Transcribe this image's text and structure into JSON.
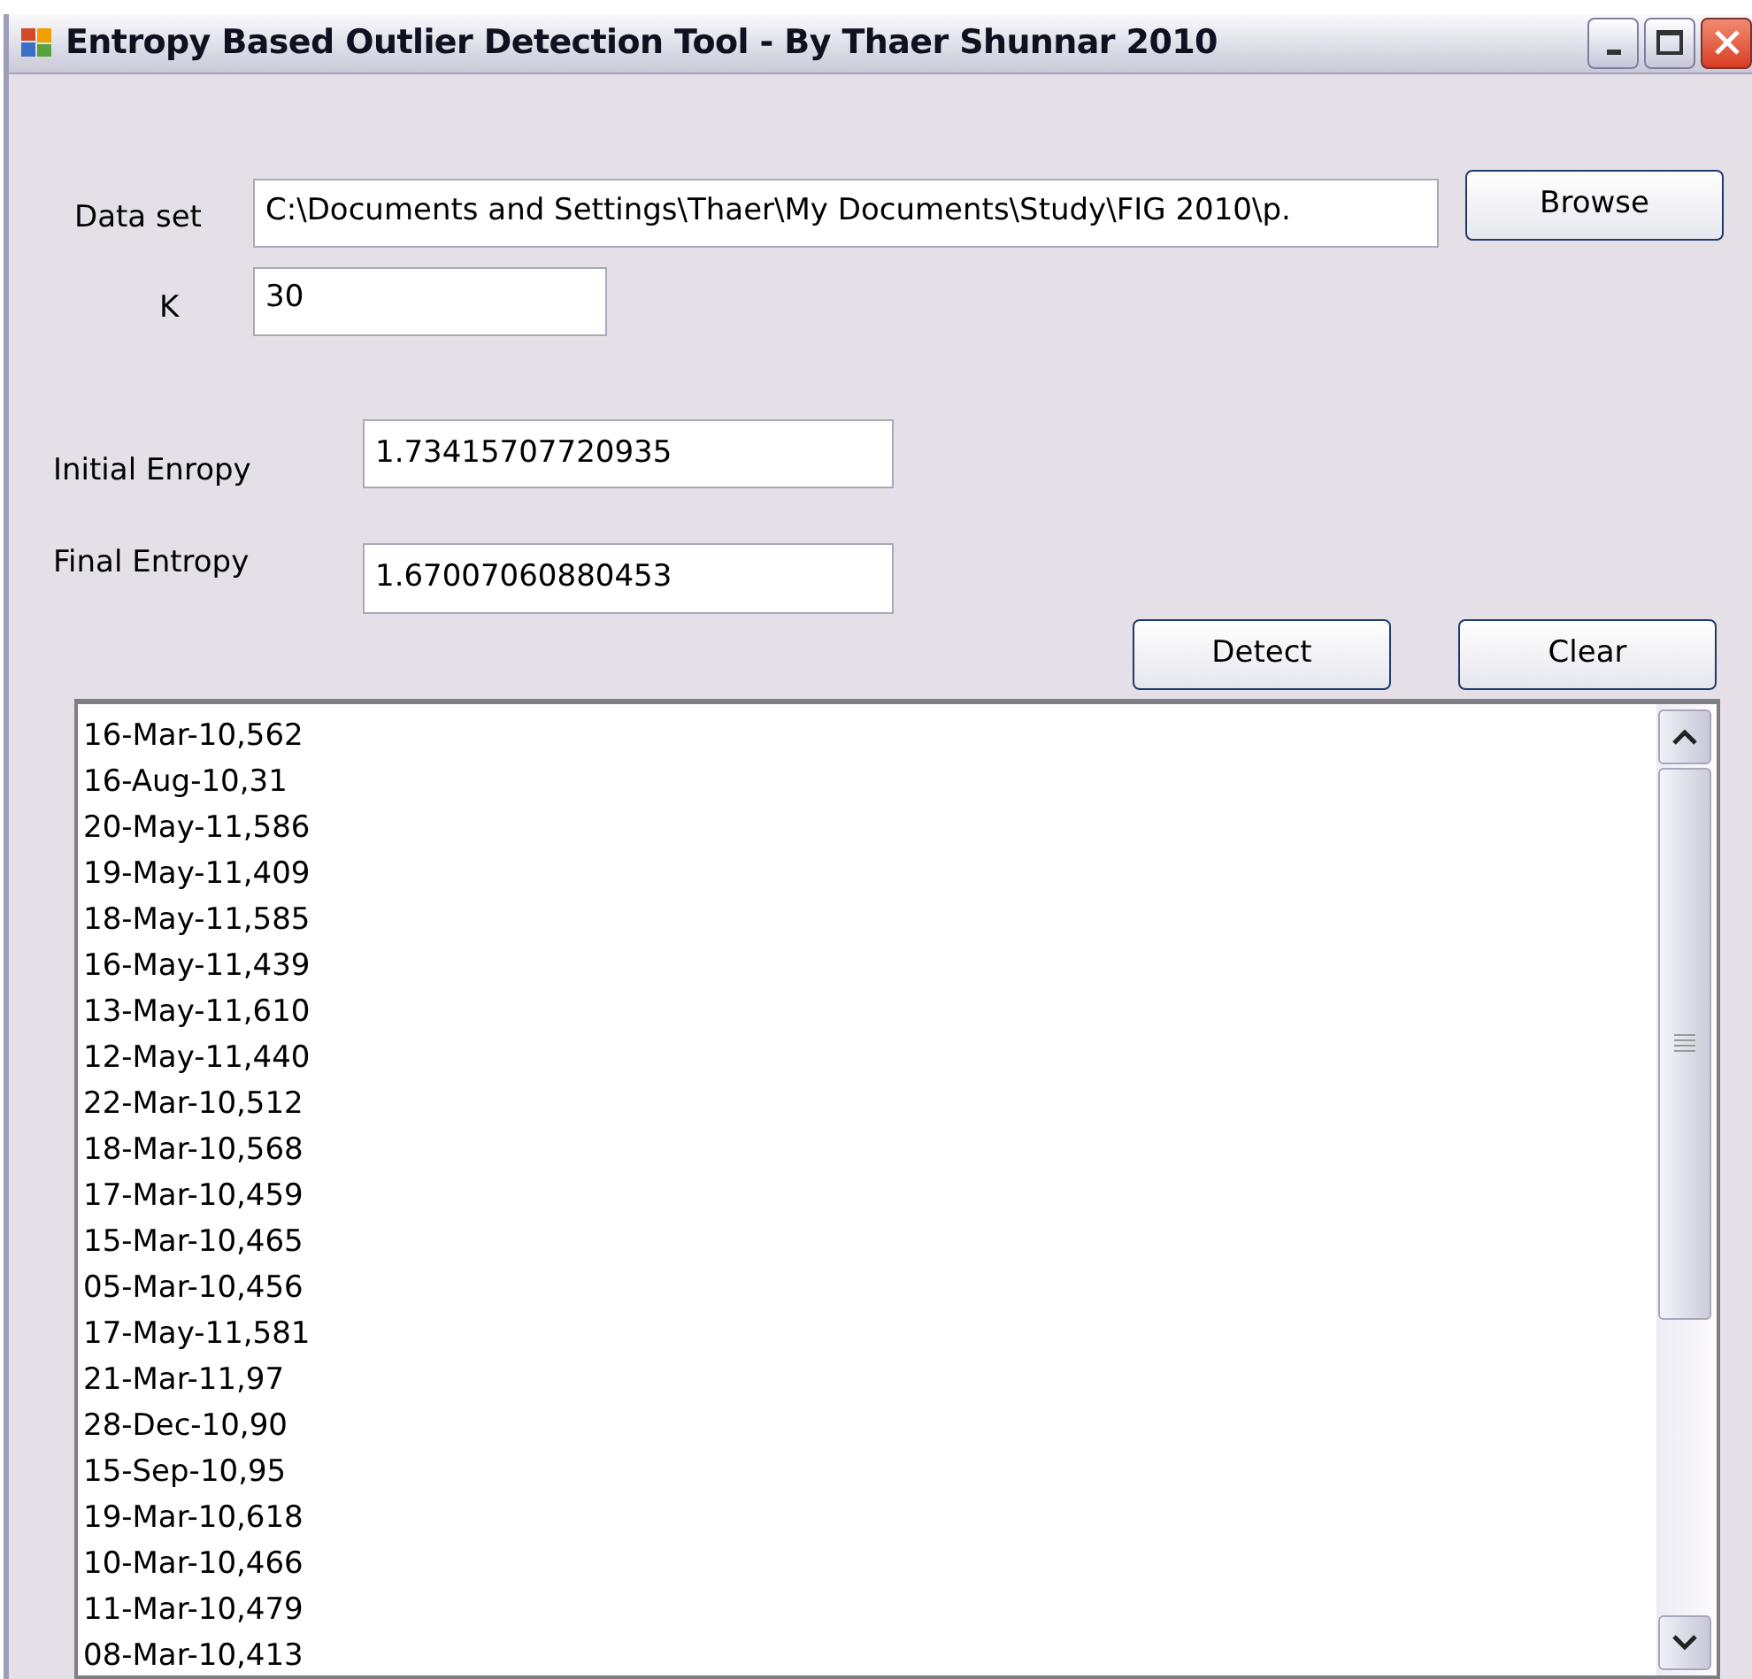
{
  "window": {
    "title": "Entropy Based Outlier Detection Tool - By Thaer Shunnar 2010"
  },
  "data_set": {
    "label": "Data set",
    "value": "C:\\Documents and Settings\\Thaer\\My Documents\\Study\\FIG 2010\\p."
  },
  "browse_button": "Browse",
  "k": {
    "label": "K",
    "value": "30"
  },
  "initial_entropy": {
    "label": "Initial Enropy",
    "value": "1.73415707720935"
  },
  "final_entropy": {
    "label": "Final Entropy",
    "value": "1.67007060880453"
  },
  "buttons": [
    "Detect",
    "Clear"
  ],
  "results": [
    "16-Mar-10,562",
    "16-Aug-10,31",
    "20-May-11,586",
    "19-May-11,409",
    "18-May-11,585",
    "16-May-11,439",
    "13-May-11,610",
    "12-May-11,440",
    "22-Mar-10,512",
    "18-Mar-10,568",
    "17-Mar-10,459",
    "15-Mar-10,465",
    "05-Mar-10,456",
    "17-May-11,581",
    "21-Mar-11,97",
    "28-Dec-10,90",
    "15-Sep-10,95",
    "19-Mar-10,618",
    "10-Mar-10,466",
    "11-Mar-10,479",
    "08-Mar-10,413"
  ]
}
